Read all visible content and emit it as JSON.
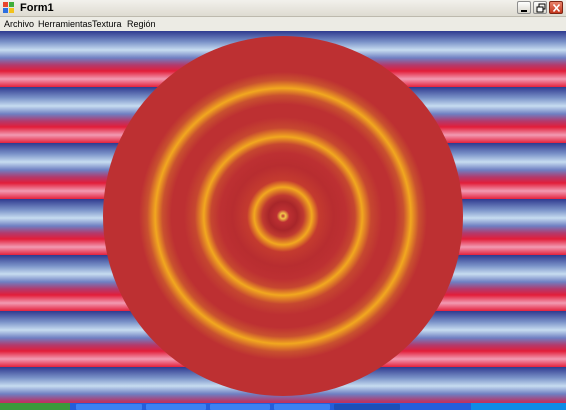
{
  "window": {
    "title": "Form1",
    "icon": "form-app-icon",
    "controls": [
      "minimize-icon",
      "restore-icon",
      "close-icon"
    ]
  },
  "menu": {
    "items": [
      {
        "label": "Archivo"
      },
      {
        "label": "Herramientas"
      },
      {
        "label": "Textura"
      },
      {
        "label": "Región"
      }
    ]
  },
  "canvas": {
    "background_stripe_colors": [
      "#2f3a8f",
      "#7b93c9",
      "#c6dcf0",
      "#6f7fc2",
      "#e21e3a",
      "#f29ab2"
    ],
    "disc_color": "#bd3032",
    "ring_color": "#f2a81f"
  },
  "taskbar": {
    "start_color": "#3a9a3a",
    "bar_color": "#245edb"
  }
}
